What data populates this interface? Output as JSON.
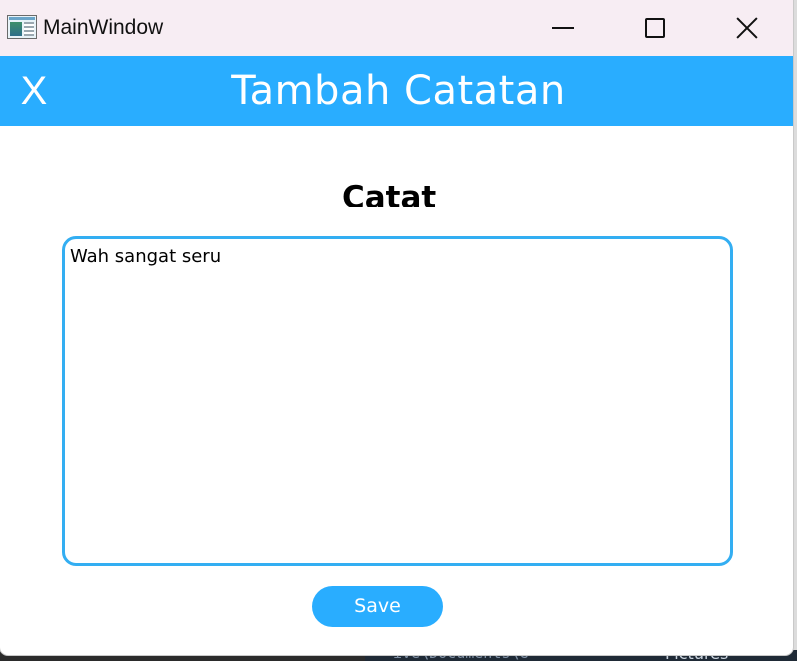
{
  "window": {
    "title": "MainWindow",
    "icon": "app-window-icon"
  },
  "header": {
    "close_label": "X",
    "title": "Tambah Catatan",
    "background_color": "#29adff"
  },
  "content": {
    "heading": "Catat",
    "note_value": "Wah sangat seru",
    "textarea_border_color": "#33aef2",
    "save_label": "Save"
  },
  "background": {
    "path_fragment": "ive\\Documents\\G",
    "folder_label": "Pictures"
  }
}
